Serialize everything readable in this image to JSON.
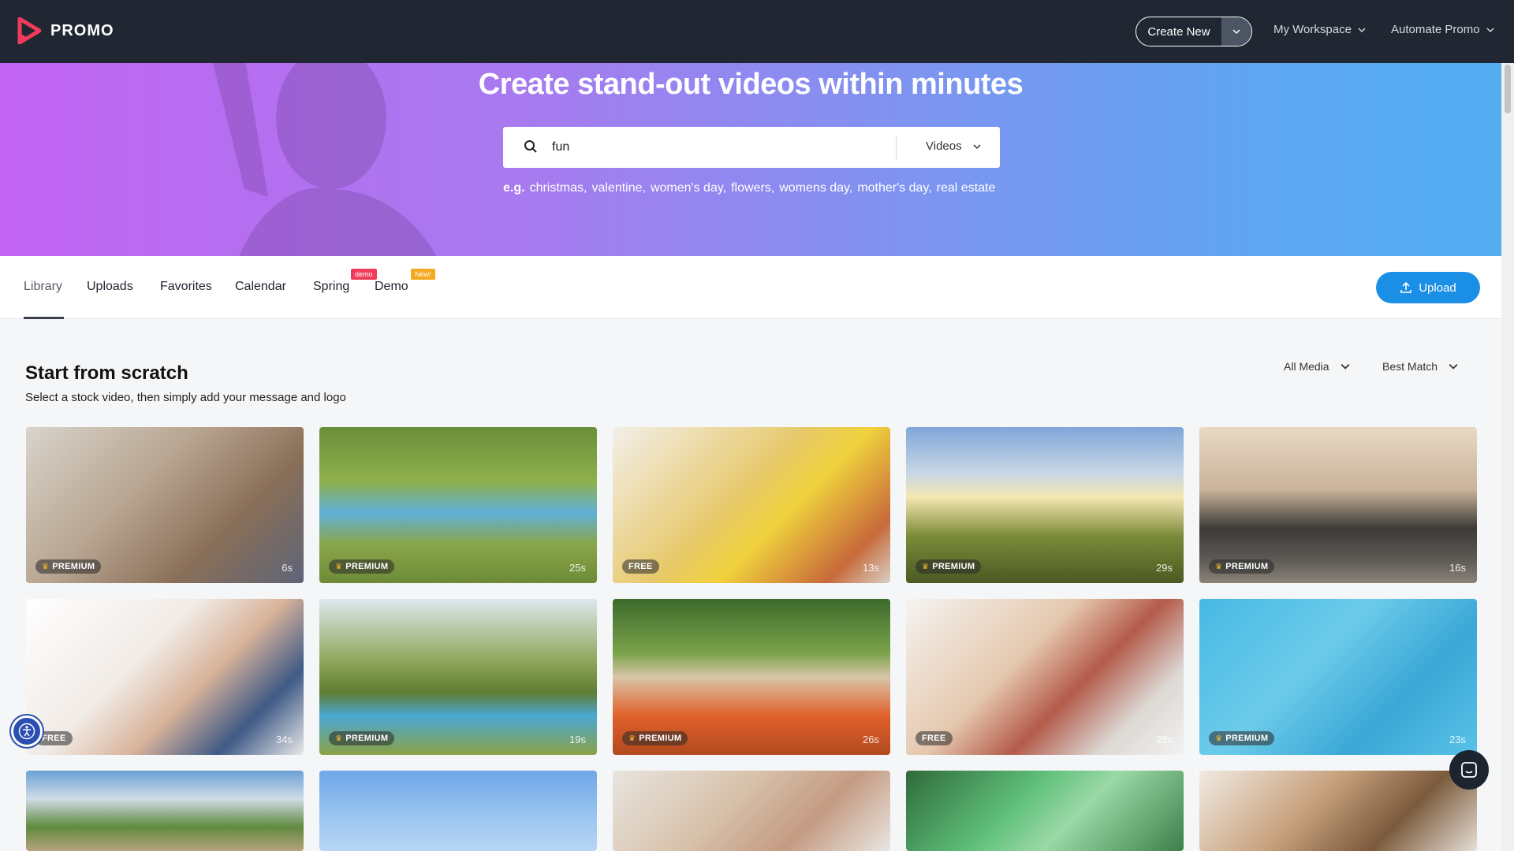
{
  "brand": {
    "name": "PROMO",
    "accent": "#f03c5a"
  },
  "header": {
    "create_new": "Create New",
    "my_workspace": "My Workspace",
    "automate": "Automate Promo"
  },
  "hero": {
    "title": "Create stand-out videos within minutes",
    "search_value": "fun",
    "search_type": "Videos",
    "eg_label": "e.g.",
    "suggestions": [
      "christmas,",
      "valentine,",
      "women's day,",
      "flowers,",
      "womens day,",
      "mother's day,",
      "real estate"
    ]
  },
  "tabs": {
    "library": "Library",
    "uploads": "Uploads",
    "favorites": "Favorites",
    "calendar": "Calendar",
    "spring": "Spring",
    "spring_badge": "demo",
    "demo": "Demo",
    "demo_badge": "New!",
    "upload": "Upload"
  },
  "section": {
    "title": "Start from scratch",
    "subtitle": "Select a stock video, then simply add your message and logo",
    "filter_media": "All Media",
    "filter_sort": "Best Match"
  },
  "cards": [
    {
      "tag": "PREMIUM",
      "dur": "6s",
      "bg": "linear-gradient(135deg,#d9d4cc 0%,#b8a591 40%,#8a6f58 70%,#5d6478 100%)"
    },
    {
      "tag": "PREMIUM",
      "dur": "25s",
      "bg": "linear-gradient(180deg,#6b8e3a 0%,#8fb04c 35%,#5fb0d8 55%,#8aa64a 75%,#6d8a36 100%)"
    },
    {
      "tag": "FREE",
      "dur": "13s",
      "bg": "linear-gradient(135deg,#f3efe9 0%,#e7c96a 45%,#f0d23c 60%,#c86a3a 85%,#d8d0c6 100%)"
    },
    {
      "tag": "PREMIUM",
      "dur": "29s",
      "bg": "linear-gradient(180deg,#7fa7d9 0%,#c9d7e4 30%,#f4e7b2 45%,#7b8a38 70%,#4a5a22 100%)"
    },
    {
      "tag": "PREMIUM",
      "dur": "16s",
      "bg": "linear-gradient(180deg,#e8d8c4 0%,#c9b39a 40%,#3c3b38 65%,#5d5a55 85%,#8a8378 100%)"
    },
    {
      "tag": "FREE",
      "dur": "34s",
      "bg": "linear-gradient(135deg,#ffffff 0%,#f1ebe6 40%,#d8b39a 60%,#3f5a86 80%,#e9e9e9 100%)"
    },
    {
      "tag": "PREMIUM",
      "dur": "19s",
      "bg": "linear-gradient(180deg,#dfe7ee 0%,#8ea65a 40%,#5f7d32 60%,#4aa7d3 75%,#8aa246 100%)"
    },
    {
      "tag": "PREMIUM",
      "dur": "26s",
      "bg": "linear-gradient(180deg,#3d6a2c 0%,#7ba34a 35%,#d8c6a8 50%,#e0602a 75%,#b34a1e 100%)"
    },
    {
      "tag": "FREE",
      "dur": "28s",
      "bg": "linear-gradient(135deg,#f5f3f1 0%,#e5c8ae 40%,#b45b4a 60%,#dcd8d3 80%,#f2f2f2 100%)"
    },
    {
      "tag": "PREMIUM",
      "dur": "23s",
      "bg": "linear-gradient(135deg,#46b9e4 0%,#6ccbea 40%,#3aa7d6 70%,#59c2e8 100%)"
    },
    {
      "tag": "",
      "dur": "",
      "bg": "linear-gradient(180deg,#6aa0d6 0%,#d0dce6 35%,#5f8a3e 70%,#b7a27e 100%)"
    },
    {
      "tag": "",
      "dur": "",
      "bg": "linear-gradient(180deg,#6fa7e8 0%,#9cc6f1 60%,#b8d6f4 100%)"
    },
    {
      "tag": "",
      "dur": "",
      "bg": "linear-gradient(135deg,#e8e4df 0%,#d8c3ac 40%,#c49b82 70%,#e9e6e2 100%)"
    },
    {
      "tag": "",
      "dur": "",
      "bg": "linear-gradient(135deg,#2f6a3a 0%,#5fc07a 40%,#9ad8a6 60%,#3c7f4a 100%)"
    },
    {
      "tag": "",
      "dur": "",
      "bg": "linear-gradient(135deg,#f0eae2 0%,#c8a27e 40%,#7b5a3c 70%,#e6dfd6 100%)"
    }
  ]
}
